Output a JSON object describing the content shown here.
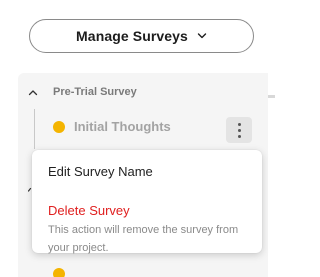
{
  "header": {
    "manage_label": "Manage Surveys",
    "chevron_icon": "chevron-down-icon"
  },
  "sidebar": {
    "group": {
      "label": "Pre-Trial Survey",
      "caret_icon": "chevron-up-icon",
      "items": [
        {
          "label": "Initial Thoughts",
          "status_color": "#f4b400",
          "menu_icon": "kebab-menu-icon"
        }
      ]
    }
  },
  "context_menu": {
    "edit_label": "Edit Survey Name",
    "delete_label": "Delete Survey",
    "delete_description": "This action will remove the survey from your project.",
    "delete_color": "#e02020"
  }
}
